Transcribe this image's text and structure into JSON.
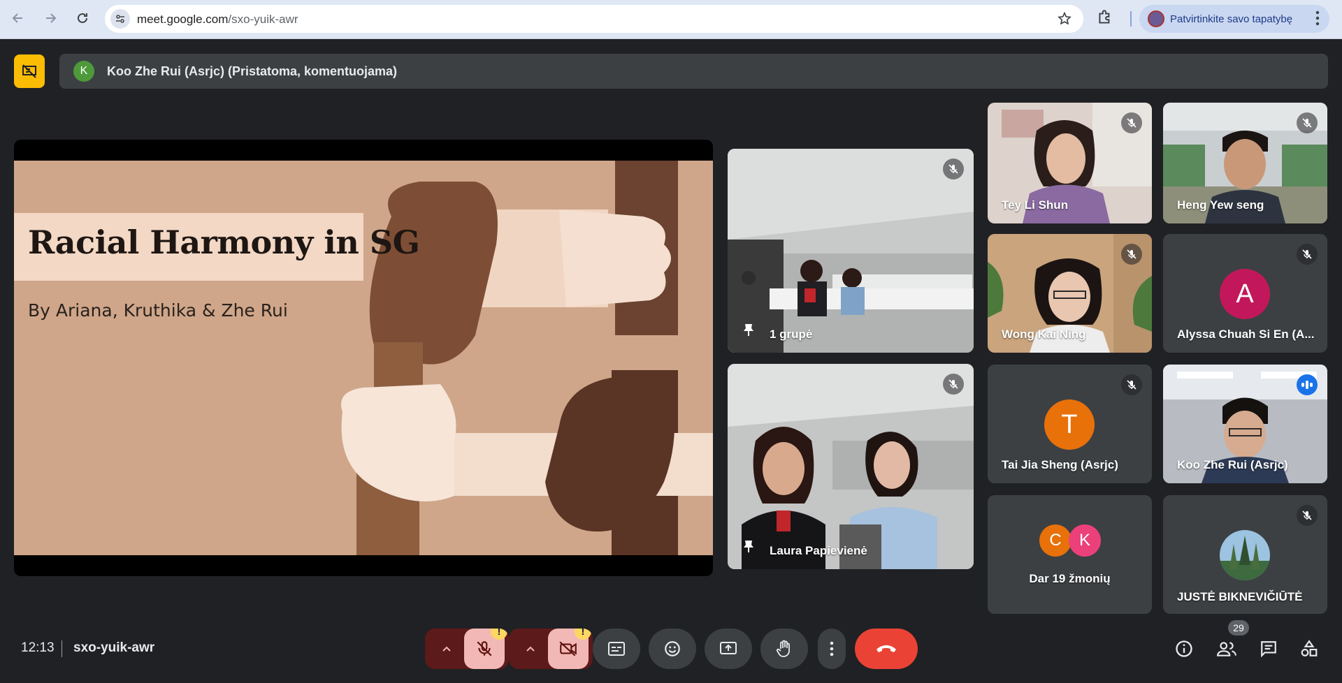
{
  "browser": {
    "url_host": "meet.google.com",
    "url_path": "/sxo-yuik-awr",
    "profile_label": "Patvirtinkite savo tapatybę"
  },
  "banner": {
    "avatar_letter": "K",
    "text": "Koo Zhe Rui (Asrjc) (Pristatoma, komentuojama)"
  },
  "slide": {
    "title": "Racial Harmony in SG",
    "subtitle": "By Ariana, Kruthika & Zhe Rui"
  },
  "tiles": [
    {
      "name": "1 grupė",
      "muted": true,
      "pinned": true
    },
    {
      "name": "Laura Papievienė",
      "muted": true,
      "pinned": true
    },
    {
      "name": "Tey Li Shun",
      "muted": true
    },
    {
      "name": "Heng Yew seng",
      "muted": true
    },
    {
      "name": "Wong Kai Ning",
      "muted": true
    },
    {
      "name": "Alyssa Chuah Si En (A...",
      "muted": true,
      "avatar_letter": "A",
      "avatar_color": "#c2185b"
    },
    {
      "name": "Tai Jia Sheng (Asrjc)",
      "muted": true,
      "avatar_letter": "T",
      "avatar_color": "#e8710a"
    },
    {
      "name": "Koo Zhe Rui (Asrjc)",
      "speaking": true
    },
    {
      "name": "Dar 19 žmonių",
      "avatar_letters": [
        "C",
        "K"
      ],
      "avatar_colors": [
        "#e8710a",
        "#ec407a"
      ]
    },
    {
      "name": "JUSTĖ BIKNEVIČIŪTĖ",
      "muted": true
    }
  ],
  "bottom_bar": {
    "time": "12:13",
    "meeting_code": "sxo-yuik-awr",
    "warning_badge": "!",
    "people_count": "29"
  },
  "colors": {
    "background": "#202124",
    "tile": "#3c4043",
    "accent": "#8ab4f8",
    "end_call": "#ea4335",
    "presenting_badge": "#fbbc04"
  }
}
